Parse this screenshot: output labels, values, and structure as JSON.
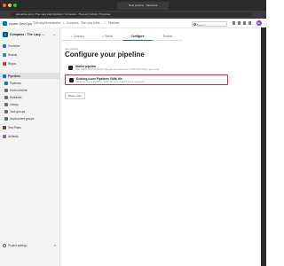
{
  "browser": {
    "tab_title": "New pipeline - Pipelines",
    "url": "dev.azure.com / The Lazy Administrator / Compass - The Lazy Admin / Pipelines",
    "traffic_colors": [
      "#ff5f57",
      "#febc2e",
      "#28c840"
    ]
  },
  "header": {
    "brand": "Azure DevOps",
    "breadcrumbs": [
      "TheLazyAdministrator",
      "/",
      "Compass - The Lazy Admi...",
      "/",
      "Pipelines"
    ],
    "search_placeholder": "Search",
    "avatar_initials": "BL",
    "accent": "#0078d4"
  },
  "sidebar": {
    "project_initial": "C",
    "project_name": "Compass - The Lazy ...",
    "items": [
      {
        "label": "Overview",
        "icon": "overview-icon",
        "color": "#1f6feb"
      },
      {
        "label": "Boards",
        "icon": "boards-icon",
        "color": "#2b9a66"
      },
      {
        "label": "Repos",
        "icon": "repos-icon",
        "color": "#d13438"
      },
      {
        "label": "Pipelines",
        "icon": "pipelines-icon",
        "color": "#0078d4"
      },
      {
        "label": "Pipelines",
        "icon": "rocket-icon",
        "color": "#0078d4"
      },
      {
        "label": "Environments",
        "icon": "environments-icon",
        "color": "#6b6b6b"
      },
      {
        "label": "Releases",
        "icon": "releases-icon",
        "color": "#6b6b6b"
      },
      {
        "label": "Library",
        "icon": "library-icon",
        "color": "#6b6b6b"
      },
      {
        "label": "Task groups",
        "icon": "task-groups-icon",
        "color": "#6b6b6b"
      },
      {
        "label": "Deployment groups",
        "icon": "deployment-groups-icon",
        "color": "#6b6b6b"
      },
      {
        "label": "Test Plans",
        "icon": "test-plans-icon",
        "color": "#a4262c"
      },
      {
        "label": "Artifacts",
        "icon": "artifacts-icon",
        "color": "#8764b8"
      }
    ],
    "active_index": 3,
    "settings_label": "Project settings",
    "collapse_glyph": "«"
  },
  "wizard": {
    "tabs": [
      "✓ Connect",
      "✓ Select",
      "Configure",
      "Review"
    ],
    "active": 2
  },
  "main": {
    "subtitle": "New pipeline",
    "title": "Configure your pipeline",
    "options": [
      {
        "title": "Starter pipeline",
        "desc": "Start with a minimal pipeline that you can customize to build and deploy your code."
      },
      {
        "title": "Existing Azure Pipelines YAML file",
        "desc": "Select an Azure Pipelines YAML file in any branch of the repository."
      }
    ],
    "show_more": "Show more"
  }
}
